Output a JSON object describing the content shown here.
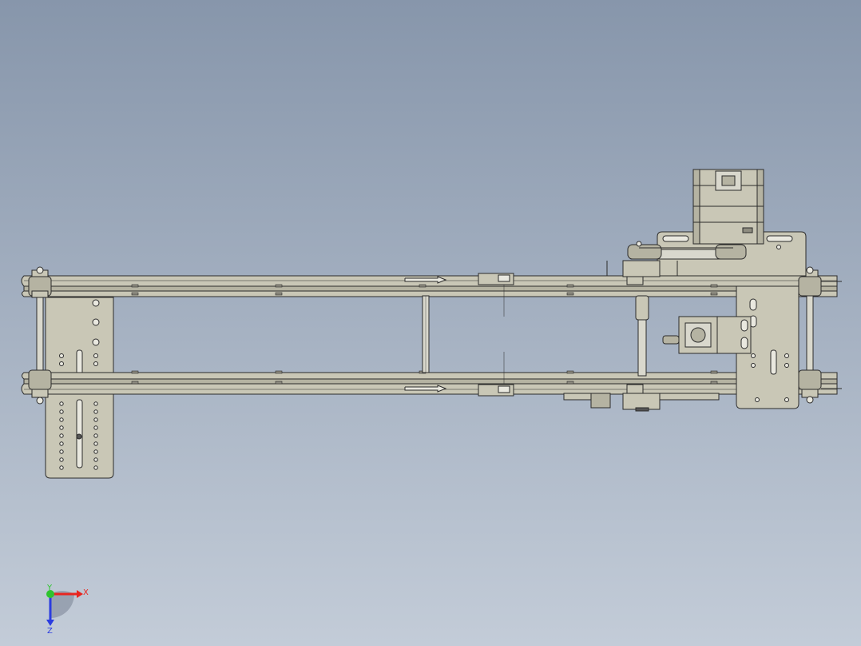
{
  "viewport": {
    "background_top": "#8796ab",
    "background_bottom": "#c3ccd8"
  },
  "model": {
    "part_fill": "#c9c7b6",
    "part_shade": "#b5b3a2",
    "edge_color": "#2b2b2b"
  },
  "triad": {
    "x_label": "X",
    "y_label": "Y",
    "z_label": "Z",
    "x_color": "#e8251f",
    "y_color": "#2ec42e",
    "z_color": "#2b3ce0"
  }
}
